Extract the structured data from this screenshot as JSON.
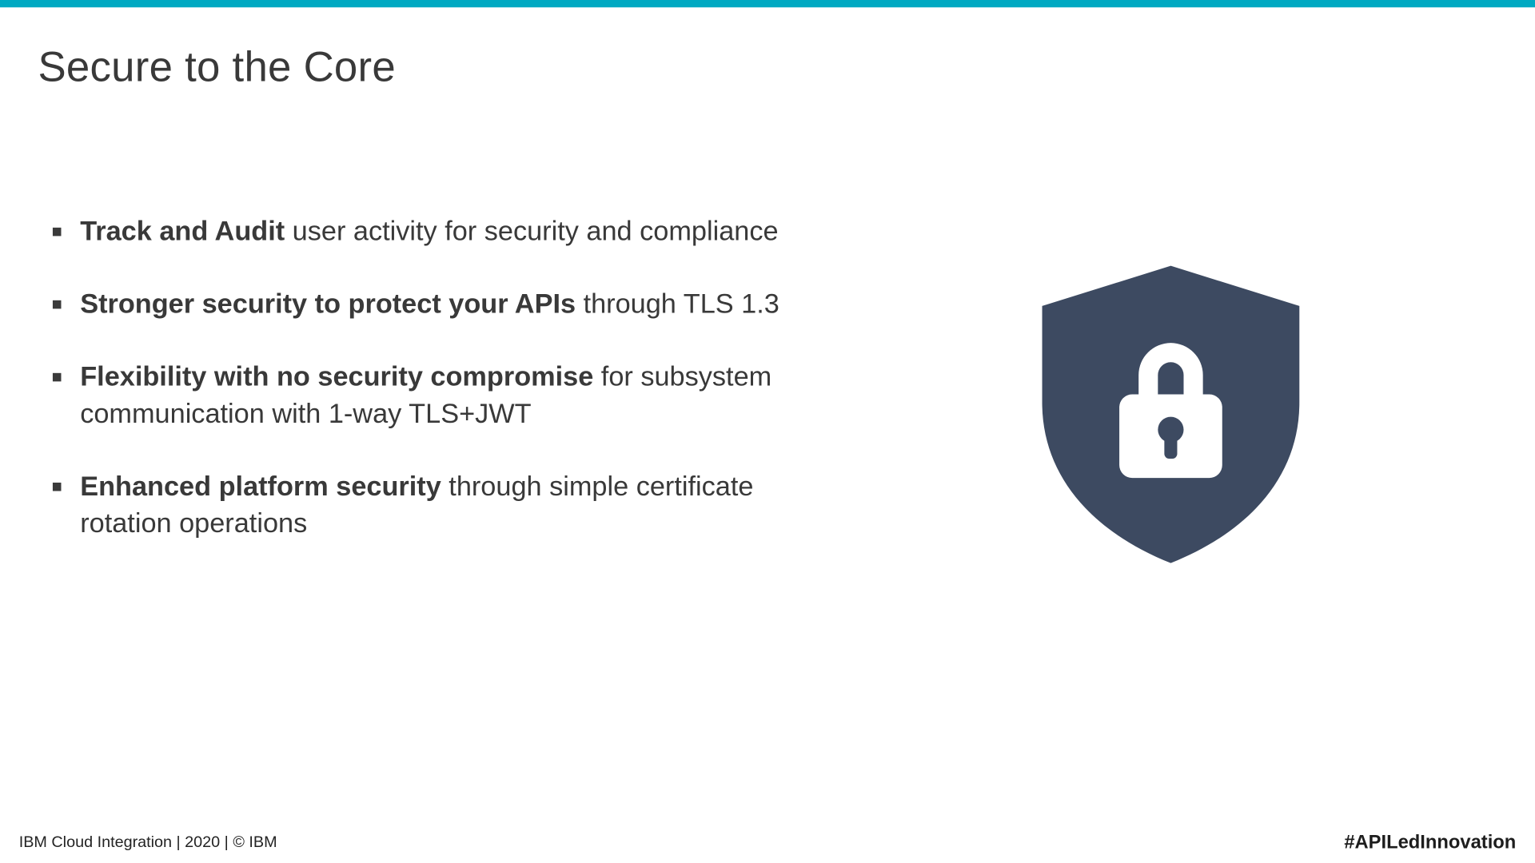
{
  "slide": {
    "title": "Secure to the Core",
    "bullets": [
      {
        "bold": "Track and Audit",
        "rest": " user activity for security and compliance"
      },
      {
        "bold": "Stronger security to protect your APIs",
        "rest": " through TLS 1.3"
      },
      {
        "bold": "Flexibility with no security compromise",
        "rest": " for subsystem communication with 1-way TLS+JWT"
      },
      {
        "bold": "Enhanced platform security",
        "rest": " through simple certificate rotation operations"
      }
    ],
    "footer_left": "IBM Cloud Integration  | 2020 | © IBM",
    "footer_right": "#APILedInnovation",
    "icon": "shield-lock-icon",
    "shield_color": "#3d4a61",
    "accent_color": "#00a9c2"
  }
}
